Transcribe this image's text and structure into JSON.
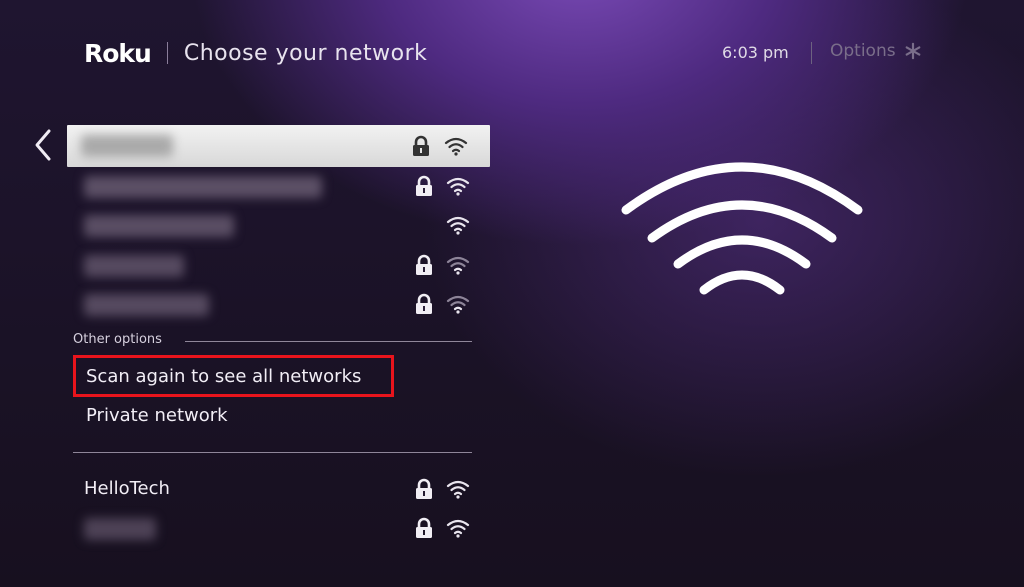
{
  "header": {
    "logo": "Roku",
    "title": "Choose your network"
  },
  "status": {
    "time": "6:03 pm",
    "options_label": "Options"
  },
  "icons": {
    "back": "chevron-left-icon",
    "options": "asterisk-icon",
    "lock": "lock-icon",
    "wifi": "wifi-icon",
    "hero": "wifi-large-icon"
  },
  "networks": [
    {
      "name": "",
      "locked": true,
      "selected": true
    },
    {
      "name": "",
      "locked": true
    },
    {
      "name": "",
      "locked": false
    },
    {
      "name": "",
      "locked": true
    },
    {
      "name": "",
      "locked": true
    }
  ],
  "other_options": {
    "label": "Other options",
    "scan_again": "Scan again to see all networks",
    "private_network": "Private network"
  },
  "more_networks": [
    {
      "name": "HelloTech",
      "locked": true
    },
    {
      "name": "",
      "locked": true
    }
  ],
  "colors": {
    "highlight_box": "#e8141c",
    "accent": "#7b4bb8"
  }
}
